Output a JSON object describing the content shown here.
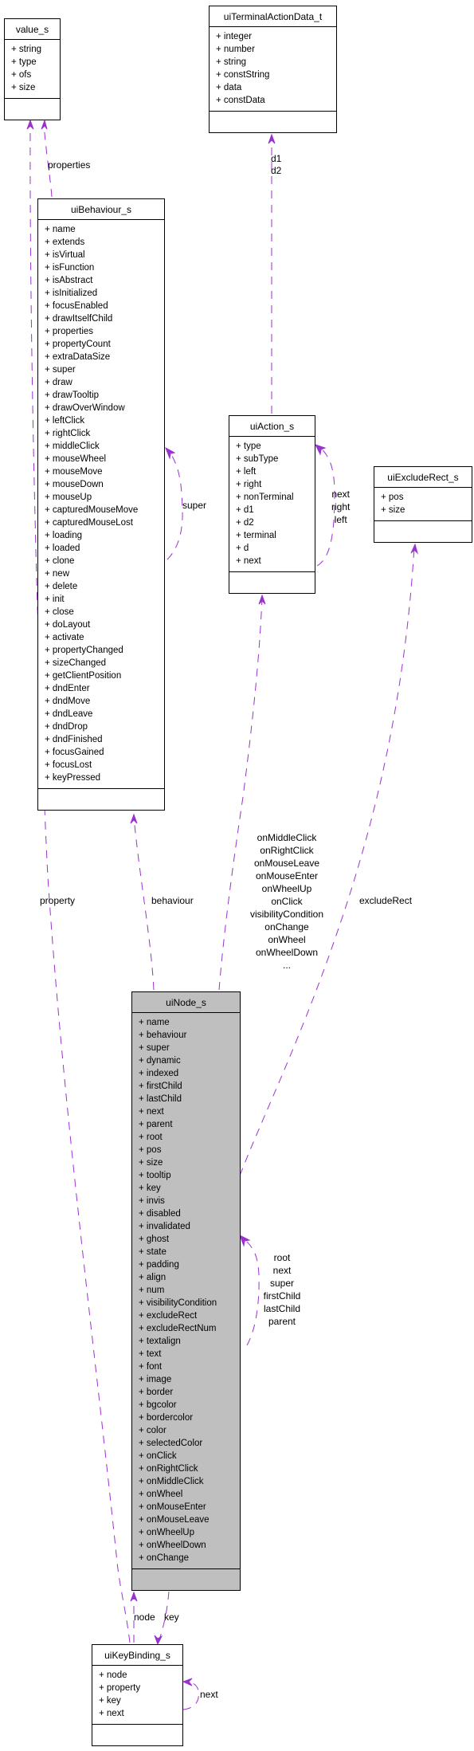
{
  "diagram": {
    "type": "collaboration-diagram",
    "focus_class": "uiNode_s"
  },
  "classes": {
    "value_s": {
      "name": "value_s",
      "attributes": [
        "+ string",
        "+ type",
        "+ ofs",
        "+ size"
      ]
    },
    "uiTerminalActionData_t": {
      "name": "uiTerminalActionData_t",
      "attributes": [
        "+ integer",
        "+ number",
        "+ string",
        "+ constString",
        "+ data",
        "+ constData"
      ]
    },
    "uiBehaviour_s": {
      "name": "uiBehaviour_s",
      "attributes": [
        "+ name",
        "+ extends",
        "+ isVirtual",
        "+ isFunction",
        "+ isAbstract",
        "+ isInitialized",
        "+ focusEnabled",
        "+ drawItselfChild",
        "+ properties",
        "+ propertyCount",
        "+ extraDataSize",
        "+ super",
        "+ draw",
        "+ drawTooltip",
        "+ drawOverWindow",
        "+ leftClick",
        "+ rightClick",
        "+ middleClick",
        "+ mouseWheel",
        "+ mouseMove",
        "+ mouseDown",
        "+ mouseUp",
        "+ capturedMouseMove",
        "+ capturedMouseLost",
        "+ loading",
        "+ loaded",
        "+ clone",
        "+ new",
        "+ delete",
        "+ init",
        "+ close",
        "+ doLayout",
        "+ activate",
        "+ propertyChanged",
        "+ sizeChanged",
        "+ getClientPosition",
        "+ dndEnter",
        "+ dndMove",
        "+ dndLeave",
        "+ dndDrop",
        "+ dndFinished",
        "+ focusGained",
        "+ focusLost",
        "+ keyPressed"
      ]
    },
    "uiAction_s": {
      "name": "uiAction_s",
      "attributes": [
        "+ type",
        "+ subType",
        "+ left",
        "+ right",
        "+ nonTerminal",
        "+ d1",
        "+ d2",
        "+ terminal",
        "+ d",
        "+ next"
      ]
    },
    "uiExcludeRect_s": {
      "name": "uiExcludeRect_s",
      "attributes": [
        "+ pos",
        "+ size"
      ]
    },
    "uiNode_s": {
      "name": "uiNode_s",
      "attributes": [
        "+ name",
        "+ behaviour",
        "+ super",
        "+ dynamic",
        "+ indexed",
        "+ firstChild",
        "+ lastChild",
        "+ next",
        "+ parent",
        "+ root",
        "+ pos",
        "+ size",
        "+ tooltip",
        "+ key",
        "+ invis",
        "+ disabled",
        "+ invalidated",
        "+ ghost",
        "+ state",
        "+ padding",
        "+ align",
        "+ num",
        "+ visibilityCondition",
        "+ excludeRect",
        "+ excludeRectNum",
        "+ textalign",
        "+ text",
        "+ font",
        "+ image",
        "+ border",
        "+ bgcolor",
        "+ bordercolor",
        "+ color",
        "+ selectedColor",
        "+ onClick",
        "+ onRightClick",
        "+ onMiddleClick",
        "+ onWheel",
        "+ onMouseEnter",
        "+ onMouseLeave",
        "+ onWheelUp",
        "+ onWheelDown",
        "+ onChange"
      ]
    },
    "uiKeyBinding_s": {
      "name": "uiKeyBinding_s",
      "attributes": [
        "+ node",
        "+ property",
        "+ key",
        "+ next"
      ]
    }
  },
  "edges": [
    {
      "from": "uiBehaviour_s",
      "to": "value_s",
      "labels": [
        "properties"
      ]
    },
    {
      "from": "uiKeyBinding_s",
      "to": "value_s",
      "labels": [
        "property"
      ]
    },
    {
      "from": "uiAction_s",
      "to": "uiTerminalActionData_t",
      "labels": [
        "d1",
        "d2"
      ]
    },
    {
      "from": "uiBehaviour_s",
      "to": "uiBehaviour_s",
      "labels": [
        "super"
      ]
    },
    {
      "from": "uiAction_s",
      "to": "uiAction_s",
      "labels": [
        "next",
        "right",
        "left"
      ]
    },
    {
      "from": "uiNode_s",
      "to": "uiBehaviour_s",
      "labels": [
        "behaviour"
      ]
    },
    {
      "from": "uiNode_s",
      "to": "uiAction_s",
      "labels": [
        "onMiddleClick",
        "onRightClick",
        "onMouseLeave",
        "onMouseEnter",
        "onWheelUp",
        "onClick",
        "visibilityCondition",
        "onChange",
        "onWheel",
        "onWheelDown",
        "..."
      ]
    },
    {
      "from": "uiNode_s",
      "to": "uiExcludeRect_s",
      "labels": [
        "excludeRect"
      ]
    },
    {
      "from": "uiNode_s",
      "to": "uiNode_s",
      "labels": [
        "root",
        "next",
        "super",
        "firstChild",
        "lastChild",
        "parent"
      ]
    },
    {
      "from": "uiKeyBinding_s",
      "to": "uiNode_s",
      "labels": [
        "node"
      ]
    },
    {
      "from": "uiNode_s",
      "to": "uiKeyBinding_s",
      "labels": [
        "key"
      ]
    },
    {
      "from": "uiKeyBinding_s",
      "to": "uiKeyBinding_s",
      "labels": [
        "next"
      ]
    }
  ],
  "colors": {
    "edge": "#9a32cd",
    "focus_fill": "#bfbfbf",
    "box_fill": "#ffffff",
    "border": "#000000"
  }
}
